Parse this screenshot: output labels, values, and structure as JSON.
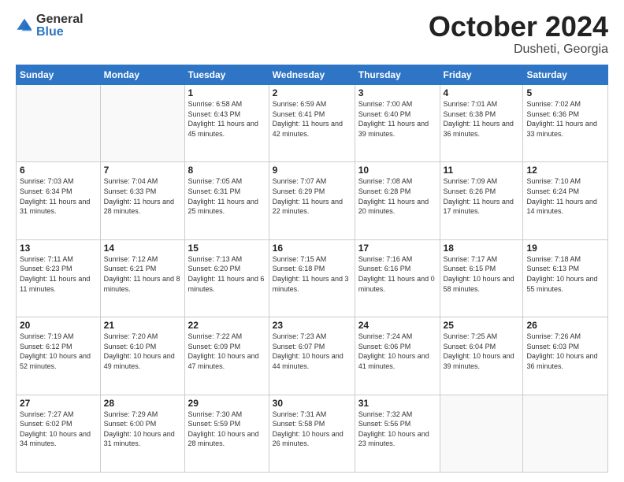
{
  "header": {
    "logo_general": "General",
    "logo_blue": "Blue",
    "month_title": "October 2024",
    "location": "Dusheti, Georgia"
  },
  "weekdays": [
    "Sunday",
    "Monday",
    "Tuesday",
    "Wednesday",
    "Thursday",
    "Friday",
    "Saturday"
  ],
  "weeks": [
    [
      {
        "day": "",
        "sunrise": "",
        "sunset": "",
        "daylight": ""
      },
      {
        "day": "",
        "sunrise": "",
        "sunset": "",
        "daylight": ""
      },
      {
        "day": "1",
        "sunrise": "Sunrise: 6:58 AM",
        "sunset": "Sunset: 6:43 PM",
        "daylight": "Daylight: 11 hours and 45 minutes."
      },
      {
        "day": "2",
        "sunrise": "Sunrise: 6:59 AM",
        "sunset": "Sunset: 6:41 PM",
        "daylight": "Daylight: 11 hours and 42 minutes."
      },
      {
        "day": "3",
        "sunrise": "Sunrise: 7:00 AM",
        "sunset": "Sunset: 6:40 PM",
        "daylight": "Daylight: 11 hours and 39 minutes."
      },
      {
        "day": "4",
        "sunrise": "Sunrise: 7:01 AM",
        "sunset": "Sunset: 6:38 PM",
        "daylight": "Daylight: 11 hours and 36 minutes."
      },
      {
        "day": "5",
        "sunrise": "Sunrise: 7:02 AM",
        "sunset": "Sunset: 6:36 PM",
        "daylight": "Daylight: 11 hours and 33 minutes."
      }
    ],
    [
      {
        "day": "6",
        "sunrise": "Sunrise: 7:03 AM",
        "sunset": "Sunset: 6:34 PM",
        "daylight": "Daylight: 11 hours and 31 minutes."
      },
      {
        "day": "7",
        "sunrise": "Sunrise: 7:04 AM",
        "sunset": "Sunset: 6:33 PM",
        "daylight": "Daylight: 11 hours and 28 minutes."
      },
      {
        "day": "8",
        "sunrise": "Sunrise: 7:05 AM",
        "sunset": "Sunset: 6:31 PM",
        "daylight": "Daylight: 11 hours and 25 minutes."
      },
      {
        "day": "9",
        "sunrise": "Sunrise: 7:07 AM",
        "sunset": "Sunset: 6:29 PM",
        "daylight": "Daylight: 11 hours and 22 minutes."
      },
      {
        "day": "10",
        "sunrise": "Sunrise: 7:08 AM",
        "sunset": "Sunset: 6:28 PM",
        "daylight": "Daylight: 11 hours and 20 minutes."
      },
      {
        "day": "11",
        "sunrise": "Sunrise: 7:09 AM",
        "sunset": "Sunset: 6:26 PM",
        "daylight": "Daylight: 11 hours and 17 minutes."
      },
      {
        "day": "12",
        "sunrise": "Sunrise: 7:10 AM",
        "sunset": "Sunset: 6:24 PM",
        "daylight": "Daylight: 11 hours and 14 minutes."
      }
    ],
    [
      {
        "day": "13",
        "sunrise": "Sunrise: 7:11 AM",
        "sunset": "Sunset: 6:23 PM",
        "daylight": "Daylight: 11 hours and 11 minutes."
      },
      {
        "day": "14",
        "sunrise": "Sunrise: 7:12 AM",
        "sunset": "Sunset: 6:21 PM",
        "daylight": "Daylight: 11 hours and 8 minutes."
      },
      {
        "day": "15",
        "sunrise": "Sunrise: 7:13 AM",
        "sunset": "Sunset: 6:20 PM",
        "daylight": "Daylight: 11 hours and 6 minutes."
      },
      {
        "day": "16",
        "sunrise": "Sunrise: 7:15 AM",
        "sunset": "Sunset: 6:18 PM",
        "daylight": "Daylight: 11 hours and 3 minutes."
      },
      {
        "day": "17",
        "sunrise": "Sunrise: 7:16 AM",
        "sunset": "Sunset: 6:16 PM",
        "daylight": "Daylight: 11 hours and 0 minutes."
      },
      {
        "day": "18",
        "sunrise": "Sunrise: 7:17 AM",
        "sunset": "Sunset: 6:15 PM",
        "daylight": "Daylight: 10 hours and 58 minutes."
      },
      {
        "day": "19",
        "sunrise": "Sunrise: 7:18 AM",
        "sunset": "Sunset: 6:13 PM",
        "daylight": "Daylight: 10 hours and 55 minutes."
      }
    ],
    [
      {
        "day": "20",
        "sunrise": "Sunrise: 7:19 AM",
        "sunset": "Sunset: 6:12 PM",
        "daylight": "Daylight: 10 hours and 52 minutes."
      },
      {
        "day": "21",
        "sunrise": "Sunrise: 7:20 AM",
        "sunset": "Sunset: 6:10 PM",
        "daylight": "Daylight: 10 hours and 49 minutes."
      },
      {
        "day": "22",
        "sunrise": "Sunrise: 7:22 AM",
        "sunset": "Sunset: 6:09 PM",
        "daylight": "Daylight: 10 hours and 47 minutes."
      },
      {
        "day": "23",
        "sunrise": "Sunrise: 7:23 AM",
        "sunset": "Sunset: 6:07 PM",
        "daylight": "Daylight: 10 hours and 44 minutes."
      },
      {
        "day": "24",
        "sunrise": "Sunrise: 7:24 AM",
        "sunset": "Sunset: 6:06 PM",
        "daylight": "Daylight: 10 hours and 41 minutes."
      },
      {
        "day": "25",
        "sunrise": "Sunrise: 7:25 AM",
        "sunset": "Sunset: 6:04 PM",
        "daylight": "Daylight: 10 hours and 39 minutes."
      },
      {
        "day": "26",
        "sunrise": "Sunrise: 7:26 AM",
        "sunset": "Sunset: 6:03 PM",
        "daylight": "Daylight: 10 hours and 36 minutes."
      }
    ],
    [
      {
        "day": "27",
        "sunrise": "Sunrise: 7:27 AM",
        "sunset": "Sunset: 6:02 PM",
        "daylight": "Daylight: 10 hours and 34 minutes."
      },
      {
        "day": "28",
        "sunrise": "Sunrise: 7:29 AM",
        "sunset": "Sunset: 6:00 PM",
        "daylight": "Daylight: 10 hours and 31 minutes."
      },
      {
        "day": "29",
        "sunrise": "Sunrise: 7:30 AM",
        "sunset": "Sunset: 5:59 PM",
        "daylight": "Daylight: 10 hours and 28 minutes."
      },
      {
        "day": "30",
        "sunrise": "Sunrise: 7:31 AM",
        "sunset": "Sunset: 5:58 PM",
        "daylight": "Daylight: 10 hours and 26 minutes."
      },
      {
        "day": "31",
        "sunrise": "Sunrise: 7:32 AM",
        "sunset": "Sunset: 5:56 PM",
        "daylight": "Daylight: 10 hours and 23 minutes."
      },
      {
        "day": "",
        "sunrise": "",
        "sunset": "",
        "daylight": ""
      },
      {
        "day": "",
        "sunrise": "",
        "sunset": "",
        "daylight": ""
      }
    ]
  ]
}
